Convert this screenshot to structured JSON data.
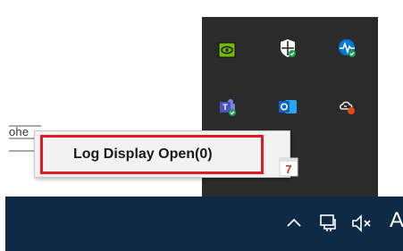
{
  "background_text": {
    "partial_label": "ohe"
  },
  "tray_flyout": {
    "icons": [
      {
        "name": "nvidia-icon",
        "color": "#76b900"
      },
      {
        "name": "windows-security-icon",
        "color": "#ffffff"
      },
      {
        "name": "network-activity-icon",
        "color": "#0078d4"
      },
      {
        "name": "teams-icon",
        "color": "#6264a7"
      },
      {
        "name": "outlook-icon",
        "color": "#0a64c8"
      },
      {
        "name": "cloud-sync-icon",
        "color": "#e8e8e8"
      }
    ]
  },
  "context_menu": {
    "item_label": "Log Display Open(0)",
    "highlight_color": "#e01b24"
  },
  "taskbar": {
    "chevron_icon": "chevron-up-icon",
    "network_icon": "network-icon",
    "volume_icon": "volume-muted-icon",
    "language_label": "A"
  }
}
